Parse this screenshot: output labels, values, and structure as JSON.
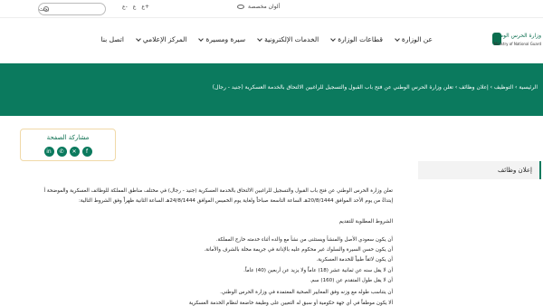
{
  "topbar": {
    "search_placeholder": "بحث",
    "size_buttons": [
      "ع-",
      "ع",
      "ع+"
    ],
    "colors_label": "ألوان مخصصة"
  },
  "header": {
    "logo_ar": "وزارة الحرس الوطني",
    "logo_en": "Ministry of National Guard",
    "menu": [
      {
        "label": "عن الوزارة",
        "has_dropdown": true
      },
      {
        "label": "قطاعات الوزارة",
        "has_dropdown": true
      },
      {
        "label": "الخدمات الإلكترونية",
        "has_dropdown": true
      },
      {
        "label": "سيرة ومسيرة",
        "has_dropdown": true
      },
      {
        "label": "المركز الإعلامي",
        "has_dropdown": true
      },
      {
        "label": "اتصل بنا",
        "has_dropdown": false
      }
    ]
  },
  "hero": {
    "breadcrumb": "الرئيسية › التوظيف › إعلان وظائف › تعلن وزارة الحرس الوطني عن فتح باب القبول والتسجيل للراغبين الالتحاق بالخدمة العسكرية (جنيد - رجال)"
  },
  "share": {
    "title": "مشاركة الصفحة",
    "icons": [
      "facebook-icon",
      "x-icon",
      "whatsapp-icon",
      "linkedin-icon"
    ]
  },
  "sidebar": {
    "item": "إعلان وظائف"
  },
  "article": {
    "lines": [
      "تعلن وزارة الحرس الوطني عن فتح باب القبول والتسجيل للراغبين الالتحاق بالخدمة العسكرية (جنيد - رجال) في مختلف مناطق المملكة للوظائف العسكرية والموضحة أ",
      "إبتداءً من يوم الأحد الموافق 20/8/1444هـ الساعة التاسعة صباحاً ولغاية يوم الخميس الموافق 24/8/1444هـ الساعة الثانية ظهراً وفق الشروط التالية:",
      "الشروط المطلوبة للتقديم",
      "أن يكون سعودي الأصل والمنشأ ويستثنى من نشأ مع والده أثناء خدمته خارج المملكة.",
      "أن يكون حسن السيرة والسلوك غير محكوم عليه بالإدانة في جريمة مخلة بالشرف والأمانة.",
      "أن يكون لائقاً طبياً للخدمة العسكرية.",
      "أن لا يقل سنه عن ثمانية عشر (18) عاماً ولا يزيد عن أربعين (40) عاماً.",
      "أن لا يقل طول المتقدم عن (160) سم.",
      "أن يتناسب طوله مع وزنه وفق المعايير الصحية المعتمدة في وزارة الحرس الوطني.",
      "ألا يكون موظفاً في أي جهة حكومية أو سبق له التعيين على وظيفة خاضعة لنظام الخدمة العسكرية"
    ]
  }
}
